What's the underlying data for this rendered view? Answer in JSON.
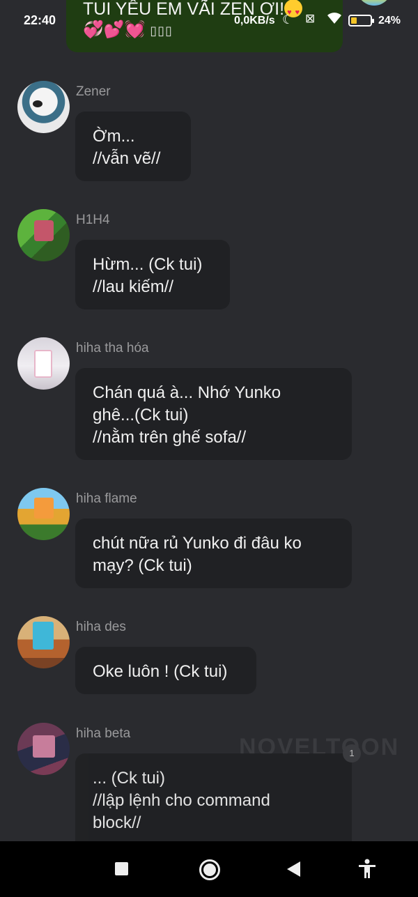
{
  "status_bar": {
    "time": "22:40",
    "speed": "0,0KB/s",
    "battery": "24%"
  },
  "top_message": {
    "line1": "TUI YÊU EM VÃI ZEN ƠI!",
    "line2_hearts": "💞💕💓",
    "line2_boxes": "▯▯▯"
  },
  "messages": [
    {
      "sender": "Zener",
      "lines": [
        "Ờm...",
        "//vẫn vẽ//"
      ]
    },
    {
      "sender": "H1H4",
      "lines": [
        "Hừm... (Ck tui)",
        "//lau kiếm//"
      ]
    },
    {
      "sender": "hiha tha hóa",
      "lines": [
        "Chán quá à... Nhớ Yunko",
        "ghê...(Ck tui)",
        "//nằm trên ghế sofa//"
      ]
    },
    {
      "sender": "hiha flame",
      "lines": [
        "chút nữa rủ Yunko đi đâu ko",
        "mạy? (Ck tui)"
      ]
    },
    {
      "sender": "hiha des",
      "lines": [
        "Oke luôn ! (Ck tui)"
      ]
    },
    {
      "sender": "hiha beta",
      "lines": [
        "... (Ck tui)",
        "//lập lệnh cho command",
        "block//"
      ]
    }
  ],
  "watermark": "NOVELTOON",
  "badge_count": "1",
  "colors": {
    "background": "#2a2b2f",
    "bubble": "#202124",
    "top_bubble": "#1f3d12",
    "sender": "#9a9a9c"
  },
  "icons": {
    "moon": "moon-icon",
    "sim": "sim-icon",
    "wifi": "wifi-icon",
    "battery": "battery-icon",
    "accessibility": "accessibility-icon"
  }
}
